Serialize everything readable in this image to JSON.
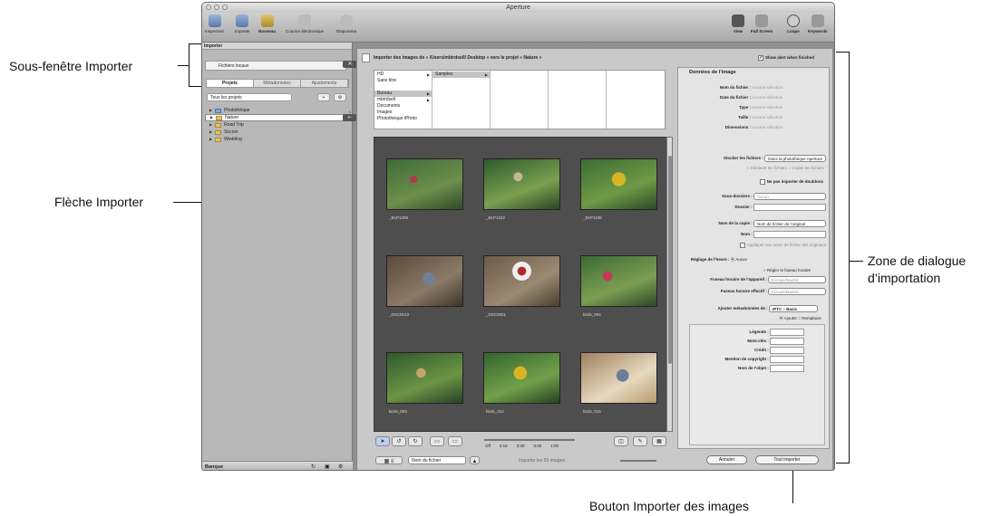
{
  "annotations": {
    "sous_fenetre": "Sous-fenêtre Importer",
    "fleche": "Flèche Importer",
    "zone": [
      "Zone de dialogue",
      "d’importation"
    ],
    "bouton": "Bouton Importer des images"
  },
  "window": {
    "title": "Aperture",
    "toolbar": {
      "left": [
        "Inspecteur",
        "Importer",
        "Nouveau",
        "Courrier électronique",
        "Diaporama"
      ],
      "right": [
        "View",
        "Full Screen",
        "Loupe",
        "Keywords"
      ]
    }
  },
  "importer": {
    "panel_title": "Importer",
    "source": "Fichiers locaux",
    "tabs": [
      "Projets",
      "Métadonnées",
      "Ajustements"
    ],
    "projects_filter": "Tous les projets",
    "tree": [
      "Photothèque",
      "Nature",
      "Road Trip",
      "Soccer",
      "Wedding"
    ],
    "bottom_label": "Banque"
  },
  "main": {
    "header": "Importer des images de « /Users/mbirdsell/ Desktop » vers le projet « Nature »",
    "show_alert": "Show alert when finished",
    "browser": {
      "col1": [
        "HD",
        "Sans titre",
        "",
        "Bureau",
        "mbirdsell",
        "Documents",
        "Images",
        "Photothèque iPhoto"
      ],
      "col2": [
        "Samples"
      ]
    },
    "thumbs": [
      "_B1P1209",
      "_B1P1222",
      "_B1P1196",
      "_DSC0143",
      "_DSC0901",
      "birds_004",
      "birds_003",
      "birds_012",
      "birds_015"
    ],
    "timeline": [
      "Off",
      "0:15",
      "0:30",
      "0:45",
      "1:00"
    ],
    "sort": "Nom du fichier",
    "count": "Importer les 55 images",
    "cancel": "Annuler",
    "import_all": "Tout importer"
  },
  "dialog": {
    "section1": "Données de l’image",
    "rows": [
      {
        "k": "Nom du fichier :",
        "v": "Aucune sélection"
      },
      {
        "k": "Date du fichier :",
        "v": "Aucune sélection"
      },
      {
        "k": "Type :",
        "v": "Aucune sélection"
      },
      {
        "k": "Taille :",
        "v": "Aucune sélection"
      },
      {
        "k": "Dimensions :",
        "v": "Aucune sélection"
      }
    ],
    "store_label": "Stocker les fichiers :",
    "store_value": "Dans la photothèque Aperture",
    "move": "Déplacer les fichiers",
    "copy": "Copier les fichiers",
    "no_dup": "Ne pas importer de doublons",
    "subfolders_label": "Sous-dossiers :",
    "subfolders_value": "Aucun",
    "folder_label": "Dossier :",
    "copy_name_label": "Nom de la copie :",
    "copy_name_value": "Nom de fichier de l’original",
    "name_label": "Nom :",
    "apply_names": "Appliquer aux noms de fichier des originaux",
    "time_label": "Réglage de l’heure :",
    "time_value": "Aucun",
    "tz_set": "Régler le fuseau horaire",
    "tz_camera_label": "Fuseau horaire de l’appareil :",
    "tz_camera_value": "Europe/Madrid",
    "tz_effective_label": "Fuseau horaire effectif :",
    "tz_effective_value": "Europe/Madrid",
    "meta_label": "Ajouter métadonnées de :",
    "meta_value": "IPTC – Basic",
    "meta_add": "Ajouter",
    "meta_replace": "Remplacer",
    "meta_fields": [
      "Légende :",
      "Mots-clés :",
      "Crédit :",
      "Mention de copyright :",
      "Nom de l’objet :"
    ]
  }
}
